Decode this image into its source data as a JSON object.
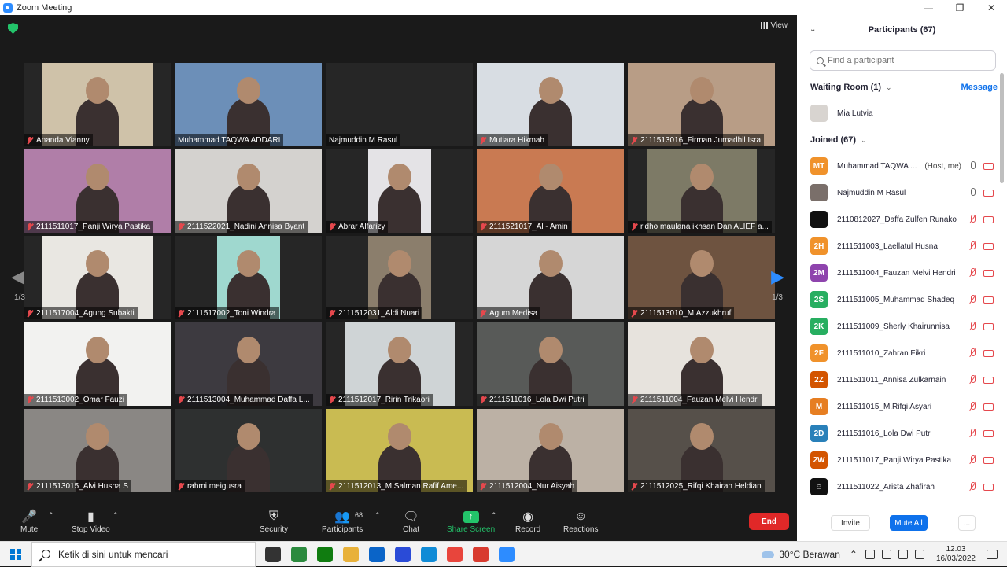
{
  "window": {
    "title": "Zoom Meeting"
  },
  "meeting": {
    "view_label": "View",
    "page_left": "1/3",
    "page_right": "1/3",
    "tiles": [
      {
        "name": "Ananda Vianny",
        "bg": "#cfc2a9",
        "w": 140,
        "mic_off": true,
        "active": false
      },
      {
        "name": "Muhammad TAQWA ADDARI",
        "bg": "#6c8fb8",
        "w": 187,
        "mic_off": false,
        "active": true
      },
      {
        "name": "Najmuddin M Rasul",
        "bg": "#262626",
        "w": 0,
        "mic_off": false,
        "active": false
      },
      {
        "name": "Mutiara Hikmah",
        "bg": "#d8dde3",
        "w": 187,
        "mic_off": true,
        "active": false
      },
      {
        "name": "2111513016_Firman Jumadhil Isra",
        "bg": "#b89d86",
        "w": 187,
        "mic_off": true,
        "active": false
      },
      {
        "name": "2111511017_Panji Wirya Pastika",
        "bg": "#b07ea8",
        "w": 187,
        "mic_off": true,
        "active": false
      },
      {
        "name": "2111522021_Nadini Annisa Byant",
        "bg": "#d4d2cf",
        "w": 187,
        "mic_off": true,
        "active": false
      },
      {
        "name": "Abrar Alfarizy",
        "bg": "#e4e3e6",
        "w": 80,
        "mic_off": true,
        "active": false
      },
      {
        "name": "2111521017_Al - Amin",
        "bg": "#c97a52",
        "w": 187,
        "mic_off": true,
        "active": false
      },
      {
        "name": "ridho maulana ikhsan Dan ALIEF a...",
        "bg": "#7d7a66",
        "w": 140,
        "mic_off": true,
        "active": false
      },
      {
        "name": "2111517004_Agung Subakti",
        "bg": "#e9e7e2",
        "w": 140,
        "mic_off": true,
        "active": false
      },
      {
        "name": "2111517002_Toni Windra",
        "bg": "#9fd8cf",
        "w": 80,
        "mic_off": true,
        "active": false
      },
      {
        "name": "2111512031_Aldi Nuari",
        "bg": "#8b7e6c",
        "w": 80,
        "mic_off": true,
        "active": false
      },
      {
        "name": "Agum Medisa",
        "bg": "#d6d6d6",
        "w": 187,
        "mic_off": true,
        "active": false
      },
      {
        "name": "2111513010_M.Azzukhruf",
        "bg": "#6e5340",
        "w": 187,
        "mic_off": true,
        "active": false
      },
      {
        "name": "2111513002_Omar Fauzi",
        "bg": "#f2f2f0",
        "w": 187,
        "mic_off": true,
        "active": false
      },
      {
        "name": "2111513004_Muhammad Daffa L...",
        "bg": "#3d3a40",
        "w": 187,
        "mic_off": true,
        "active": false
      },
      {
        "name": "2111512017_Ririn Trikaori",
        "bg": "#cfd4d6",
        "w": 140,
        "mic_off": true,
        "active": false
      },
      {
        "name": "2111511016_Lola Dwi Putri",
        "bg": "#585a58",
        "w": 187,
        "mic_off": true,
        "active": false
      },
      {
        "name": "2111511004_Fauzan Melvi Hendri",
        "bg": "#e7e3dd",
        "w": 187,
        "mic_off": true,
        "active": false
      },
      {
        "name": "2111513015_Alvi Husna S",
        "bg": "#8a8784",
        "w": 187,
        "mic_off": true,
        "active": false
      },
      {
        "name": "rahmi meigusra",
        "bg": "#2e3030",
        "w": 187,
        "mic_off": true,
        "active": false
      },
      {
        "name": "2111512013_M.Salman Rafif Ame...",
        "bg": "#c9bb52",
        "w": 187,
        "mic_off": true,
        "active": false
      },
      {
        "name": "2111512004_Nur Aisyah",
        "bg": "#bcb1a5",
        "w": 187,
        "mic_off": true,
        "active": false
      },
      {
        "name": "2111512025_Rifqi Khairan Heldian",
        "bg": "#56504a",
        "w": 187,
        "mic_off": true,
        "active": false
      }
    ]
  },
  "toolbar": {
    "mute": "Mute",
    "stop_video": "Stop Video",
    "security": "Security",
    "participants": "Participants",
    "participants_count": "68",
    "chat": "Chat",
    "share_screen": "Share Screen",
    "record": "Record",
    "reactions": "Reactions",
    "end": "End"
  },
  "panel": {
    "title": "Participants (67)",
    "search_placeholder": "Find a participant",
    "waiting_room": "Waiting Room (1)",
    "message": "Message",
    "waiting": [
      {
        "name": "Mia Lutvia",
        "initials": "",
        "color": "#d8d4d0"
      }
    ],
    "joined": "Joined (67)",
    "participants": [
      {
        "name": "Muhammad TAQWA ...",
        "role": "(Host, me)",
        "initials": "MT",
        "color": "#f0922b",
        "mic": "on",
        "cam": "off"
      },
      {
        "name": "Najmuddin M Rasul",
        "role": "",
        "initials": "",
        "color": "#7a6f6a",
        "mic": "on",
        "cam": "off"
      },
      {
        "name": "2110812027_Daffa Zulfen Runako",
        "role": "",
        "initials": "",
        "color": "#111111",
        "mic": "off",
        "cam": "off"
      },
      {
        "name": "2111511003_Laellatul Husna",
        "role": "",
        "initials": "2H",
        "color": "#f0922b",
        "mic": "off",
        "cam": "off"
      },
      {
        "name": "2111511004_Fauzan Melvi Hendri",
        "role": "",
        "initials": "2M",
        "color": "#8e44ad",
        "mic": "off",
        "cam": "off"
      },
      {
        "name": "2111511005_Muhammad Shadeq",
        "role": "",
        "initials": "2S",
        "color": "#27ae60",
        "mic": "off",
        "cam": "off"
      },
      {
        "name": "2111511009_Sherly Khairunnisa",
        "role": "",
        "initials": "2K",
        "color": "#27ae60",
        "mic": "off",
        "cam": "off"
      },
      {
        "name": "2111511010_Zahran Fikri",
        "role": "",
        "initials": "2F",
        "color": "#f0922b",
        "mic": "off",
        "cam": "off"
      },
      {
        "name": "2111511011_Annisa Zulkarnain",
        "role": "",
        "initials": "2Z",
        "color": "#d35400",
        "mic": "off",
        "cam": "off"
      },
      {
        "name": "2111511015_M.Rifqi Asyari",
        "role": "",
        "initials": "M",
        "color": "#e67e22",
        "mic": "off",
        "cam": "off"
      },
      {
        "name": "2111511016_Lola Dwi Putri",
        "role": "",
        "initials": "2D",
        "color": "#2980b9",
        "mic": "off",
        "cam": "off"
      },
      {
        "name": "2111511017_Panji Wirya Pastika",
        "role": "",
        "initials": "2W",
        "color": "#d35400",
        "mic": "off",
        "cam": "off"
      },
      {
        "name": "2111511022_Arista Zhafirah",
        "role": "",
        "initials": "☺",
        "color": "#111111",
        "mic": "off",
        "cam": "off"
      }
    ],
    "invite": "Invite",
    "mute_all": "Mute All",
    "more": "..."
  },
  "taskbar": {
    "search_placeholder": "Ketik di sini untuk mencari",
    "weather": "30°C  Berawan",
    "time": "12.03",
    "date": "16/03/2022",
    "apps": [
      "#333333",
      "#2b8a3e",
      "#107c10",
      "#e8b13a",
      "#0a64c8",
      "#2a4bd7",
      "#0f8bd6",
      "#e8453c",
      "#d83b2f",
      "#2d8cff"
    ]
  }
}
